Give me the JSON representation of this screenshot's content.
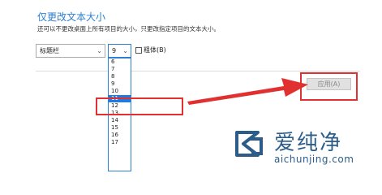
{
  "section": {
    "title": "仅更改文本大小",
    "description": "还可以不更改桌面上所有项目的大小，只更改指定项目的文本大小。"
  },
  "item_select": {
    "value": "标题栏",
    "chevron": "chevron-down-icon"
  },
  "size_select": {
    "value": "9",
    "chevron": "chevron-down-icon",
    "options": [
      "6",
      "7",
      "8",
      "9",
      "10",
      "11",
      "12",
      "13",
      "14",
      "15",
      "16",
      "17"
    ],
    "selected": "11"
  },
  "bold_checkbox": {
    "label": "粗体(B)",
    "checked": false
  },
  "apply_button": {
    "label": "应用(A)",
    "enabled": false
  },
  "annotations": {
    "color": "#e03030",
    "arrow_icon": "red-arrow-icon"
  },
  "watermark": {
    "brand": "爱纯净",
    "url": "aichunjing.com"
  },
  "colors": {
    "accent": "#2a7fd4",
    "selection": "#1e7be0",
    "highlight": "#e03030"
  }
}
